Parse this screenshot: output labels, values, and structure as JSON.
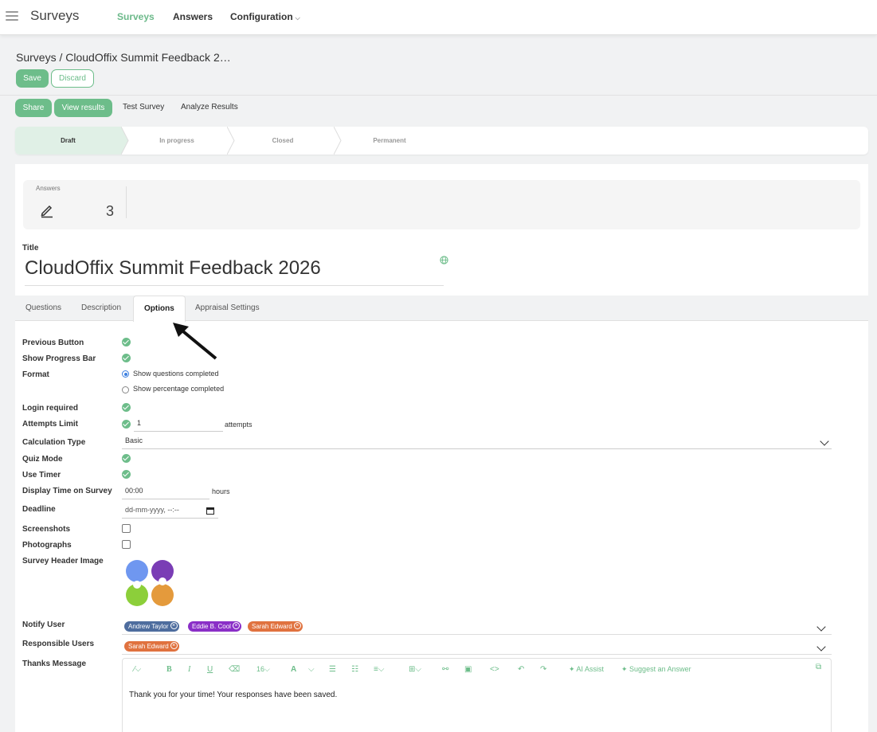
{
  "nav": {
    "app_title": "Surveys",
    "items": [
      {
        "label": "Surveys",
        "active": true
      },
      {
        "label": "Answers",
        "active": false
      },
      {
        "label": "Configuration",
        "active": false
      }
    ]
  },
  "breadcrumb": "Surveys /  CloudOffix Summit Feedback 2…",
  "actions": {
    "save": "Save",
    "discard": "Discard"
  },
  "header_buttons": {
    "share": "Share",
    "view_results": "View results",
    "test_survey": "Test Survey",
    "analyze_results": "Analyze Results"
  },
  "stages": [
    {
      "label": "Draft",
      "active": true
    },
    {
      "label": "In progress",
      "active": false
    },
    {
      "label": "Closed",
      "active": false
    },
    {
      "label": "Permanent",
      "active": false
    }
  ],
  "stat": {
    "label": "Answers",
    "value": "3"
  },
  "title": {
    "label": "Title",
    "value": "CloudOffix Summit Feedback 2026"
  },
  "tabs": [
    {
      "label": "Questions",
      "active": false
    },
    {
      "label": "Description",
      "active": false
    },
    {
      "label": "Options",
      "active": true
    },
    {
      "label": "Appraisal Settings",
      "active": false
    }
  ],
  "options": {
    "previous_button": "Previous Button",
    "show_progress_bar": "Show Progress Bar",
    "format": {
      "label": "Format",
      "opt1": "Show questions completed",
      "opt2": "Show percentage completed",
      "selected": "Show questions completed"
    },
    "login_required": "Login required",
    "attempts_limit": {
      "label": "Attempts Limit",
      "value": "1",
      "unit": "attempts"
    },
    "calculation_type": {
      "label": "Calculation Type",
      "value": "Basic"
    },
    "quiz_mode": "Quiz Mode",
    "use_timer": "Use Timer",
    "display_time": {
      "label": "Display Time on Survey",
      "value": "00:00",
      "unit": "hours"
    },
    "deadline": {
      "label": "Deadline",
      "placeholder": "dd-mm-yyyy, --:--"
    },
    "screenshots": "Screenshots",
    "photographs": "Photographs",
    "header_image": "Survey Header Image",
    "notify_user": {
      "label": "Notify User",
      "tags": [
        {
          "name": "Andrew Taylor",
          "color": "#4e6d9e"
        },
        {
          "name": "Eddie B. Cool",
          "color": "#8a2fc7"
        },
        {
          "name": "Sarah Edward",
          "color": "#e0723f"
        }
      ]
    },
    "responsible_users": {
      "label": "Responsible Users",
      "tags": [
        {
          "name": "Sarah Edward",
          "color": "#e0723f"
        }
      ]
    },
    "thanks_message": {
      "label": "Thanks Message",
      "font_size": "16",
      "ai_assist": "AI Assist",
      "suggest": "Suggest an Answer",
      "content": "Thank you for your time! Your responses have been saved."
    }
  },
  "colors": {
    "accent": "#6dbd8a",
    "active_stage": "#e0f0e6"
  }
}
